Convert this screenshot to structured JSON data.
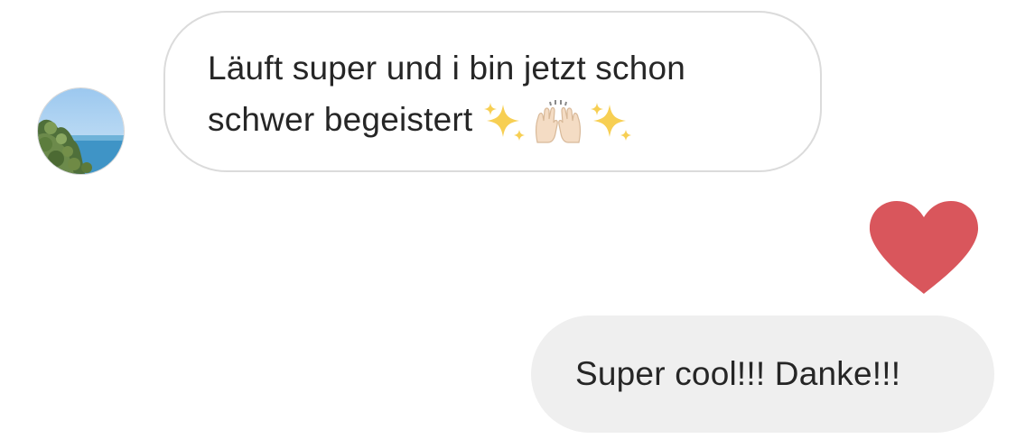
{
  "conversation": {
    "incoming": {
      "avatar_icon": "profile-photo-coastal-landscape",
      "text_line_1": "Läuft super und i bin jetzt schon",
      "text_line_2": "schwer begeistert",
      "emojis": [
        "sparkles",
        "raising-hands",
        "sparkles"
      ]
    },
    "reaction": {
      "icon": "heart-icon",
      "color": "#d9565c"
    },
    "outgoing": {
      "text": "Super cool!!! Danke!!!",
      "bubble_color": "#efefef"
    }
  }
}
